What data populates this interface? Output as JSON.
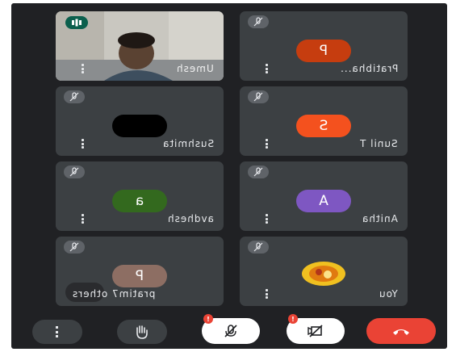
{
  "tiles": [
    {
      "name": "Umesh",
      "type": "video"
    },
    {
      "name": "Pratibha...",
      "avatar": "P",
      "color": "#c63d0f"
    },
    {
      "name": "Sushmita",
      "avatar": "",
      "color": "#000000"
    },
    {
      "name": "Sunil T",
      "avatar": "S",
      "color": "#f4511e"
    },
    {
      "name": "avdhesh",
      "avatar": "a",
      "color": "#33691e"
    },
    {
      "name": "Anitha",
      "avatar": "A",
      "color": "#7e57c2"
    },
    {
      "name": "pratim7 others",
      "avatar": "P",
      "color": "#8d6e63"
    },
    {
      "name": "You",
      "type": "self"
    }
  ],
  "controls": {
    "mic_badge": "!",
    "camera_badge": "!"
  },
  "colors": {
    "background": "#202124",
    "tile": "#3c4043",
    "end_call": "#ea4335"
  }
}
